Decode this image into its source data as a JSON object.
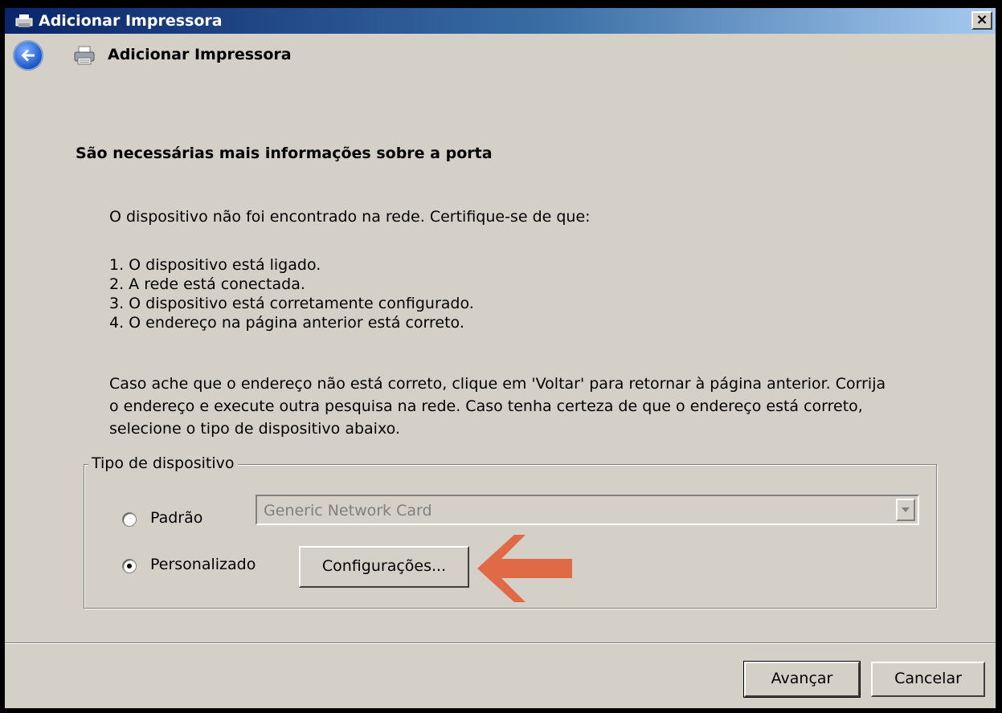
{
  "window": {
    "title": "Adicionar Impressora",
    "close_glyph": "×"
  },
  "nav": {
    "title": "Adicionar Impressora"
  },
  "content": {
    "heading": "São necessárias mais informações sobre a porta",
    "intro": "O dispositivo não foi encontrado na rede.  Certifique-se de que:",
    "checklist": [
      "1.  O dispositivo está ligado.",
      "2.  A rede está conectada.",
      "3.  O dispositivo está corretamente configurado.",
      "4.  O endereço na página anterior está correto."
    ],
    "instructions": [
      "Caso ache que o endereço não está correto, clique em 'Voltar' para retornar à página anterior. Corrija",
      "o endereço e execute outra pesquisa na rede. Caso tenha certeza de que o endereço está correto,",
      "selecione o tipo de dispositivo abaixo."
    ]
  },
  "device_type": {
    "legend": "Tipo de dispositivo",
    "standard_label": "Padrão",
    "standard_selected": false,
    "standard_value": "Generic Network Card",
    "custom_label": "Personalizado",
    "custom_selected": true,
    "settings_button": "Configurações..."
  },
  "footer": {
    "next_button": "Avançar",
    "cancel_button": "Cancelar"
  },
  "colors": {
    "annotation_arrow": "#e06a45",
    "dialog_background": "#d4d0c8",
    "titlebar_start": "#0a246a"
  },
  "icons": [
    "printer-icon",
    "back-arrow-icon",
    "close-icon",
    "dropdown-arrow-icon"
  ]
}
